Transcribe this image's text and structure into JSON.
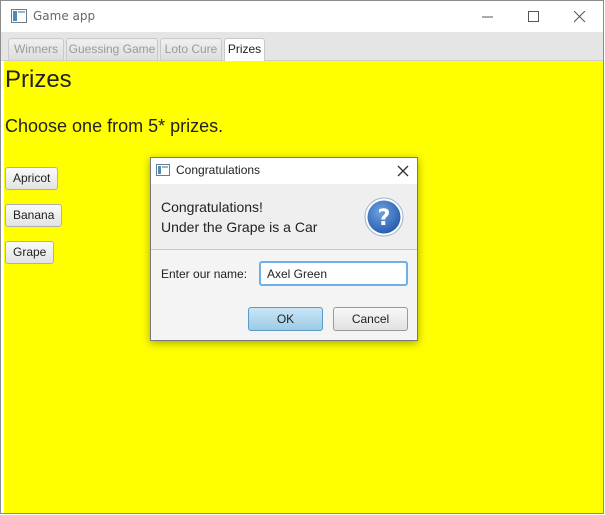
{
  "window": {
    "title": "Game app"
  },
  "tabs": [
    {
      "label": "Winners",
      "active": false
    },
    {
      "label": "Guessing Game",
      "active": false
    },
    {
      "label": "Loto Cure",
      "active": false
    },
    {
      "label": "Prizes",
      "active": true
    }
  ],
  "content": {
    "background": "#ffff00",
    "title": "Prizes",
    "subtitle": "Choose one from 5* prizes.",
    "buttons": [
      "Apricot",
      "Banana",
      "Grape"
    ]
  },
  "dialog": {
    "title": "Congratulations",
    "header_line1": "Congratulations!",
    "header_line2": "Under the Grape is a Car",
    "icon": "question-icon",
    "label": "Enter our name:",
    "input_value": "Axel Green",
    "ok_label": "OK",
    "cancel_label": "Cancel"
  }
}
